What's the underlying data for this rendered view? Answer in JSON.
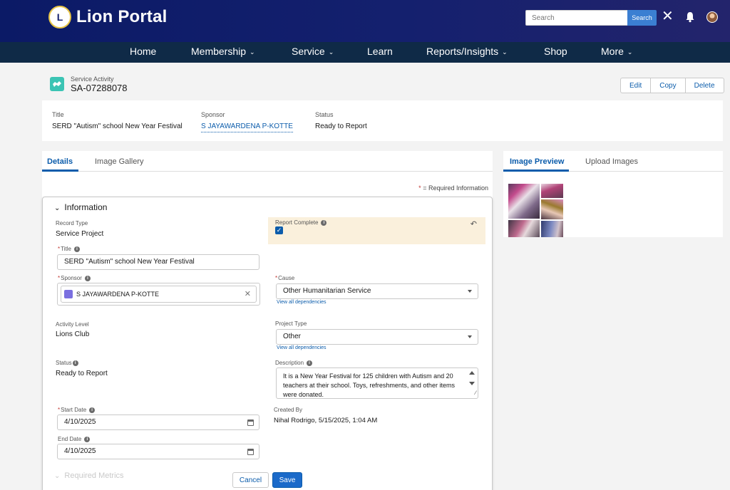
{
  "brand": {
    "name": "Lion Portal",
    "badge": "L"
  },
  "header": {
    "search_placeholder": "Search",
    "search_button": "Search",
    "close_glyph": "✕"
  },
  "nav": [
    {
      "label": "Home",
      "has_menu": false
    },
    {
      "label": "Membership",
      "has_menu": true
    },
    {
      "label": "Service",
      "has_menu": true
    },
    {
      "label": "Learn",
      "has_menu": false
    },
    {
      "label": "Reports/Insights",
      "has_menu": true
    },
    {
      "label": "Shop",
      "has_menu": false
    },
    {
      "label": "More",
      "has_menu": true
    }
  ],
  "record": {
    "type": "Service Activity",
    "name": "SA-07288078",
    "actions": [
      "Edit",
      "Copy",
      "Delete"
    ]
  },
  "highlights": {
    "title_label": "Title",
    "title_value": "SERD \"Autism\" school New Year Festival",
    "sponsor_label": "Sponsor",
    "sponsor_value": "S JAYAWARDENA P-KOTTE",
    "status_label": "Status",
    "status_value": "Ready to Report"
  },
  "left_tabs": [
    "Details",
    "Image Gallery"
  ],
  "required_info": "= Required Information",
  "form": {
    "section": "Information",
    "record_type_label": "Record Type",
    "record_type_value": "Service Project",
    "report_complete_label": "Report Complete",
    "report_complete_checked": true,
    "title_label": "Title",
    "title_value": "SERD \"Autism\" school  New Year Festival",
    "sponsor_label": "Sponsor",
    "sponsor_value": "S JAYAWARDENA P-KOTTE",
    "cause_label": "Cause",
    "cause_value": "Other Humanitarian Service",
    "view_dependencies": "View all dependencies",
    "activity_level_label": "Activity Level",
    "activity_level_value": "Lions Club",
    "project_type_label": "Project Type",
    "project_type_value": "Other",
    "status_label": "Status",
    "status_value": "Ready to Report",
    "description_label": "Description",
    "description_value": "It is a New Year Festival for 125 children with Autism and  20 teachers at their school. Toys, refreshments, and other items were donated.",
    "start_date_label": "Start Date",
    "start_date_value": "4/10/2025",
    "end_date_label": "End Date",
    "end_date_value": "4/10/2025",
    "created_by_label": "Created By",
    "created_by_value": "Nihal Rodrigo, 5/15/2025, 1:04 AM",
    "next_section": "Required Metrics",
    "cancel": "Cancel",
    "save": "Save"
  },
  "right_tabs": [
    "Image Preview",
    "Upload Images"
  ],
  "colors": {
    "header_bg": "#14206e",
    "nav_bg": "#0f2a47",
    "accent": "#0b5cab",
    "required": "#c23934",
    "report_box": "#faf0dc",
    "record_icon": "#3bc4b4"
  }
}
